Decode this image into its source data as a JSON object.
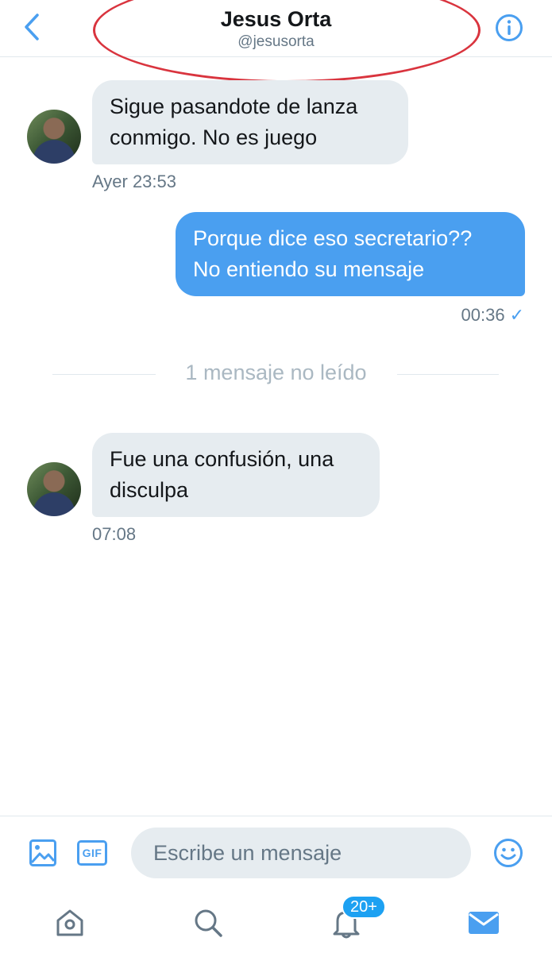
{
  "header": {
    "title": "Jesus Orta",
    "handle": "@jesusorta"
  },
  "messages": [
    {
      "direction": "in",
      "lines": [
        "Sigue pasandote de lanza",
        "conmigo. No es juego"
      ],
      "time": "Ayer 23:53"
    },
    {
      "direction": "out",
      "lines": [
        "Porque dice eso secretario??",
        "No entiendo su mensaje"
      ],
      "time": "00:36",
      "status": "✓"
    },
    {
      "direction": "in",
      "lines": [
        "Fue una confusión, una",
        "disculpa"
      ],
      "time": "07:08"
    }
  ],
  "unread_divider": "1 mensaje no leído",
  "composer": {
    "placeholder": "Escribe un mensaje",
    "gif_label": "GIF"
  },
  "tabbar": {
    "notifications_badge": "20+"
  },
  "colors": {
    "accent": "#4a9ff0",
    "incoming_bubble": "#e6ecf0",
    "annotation_oval": "#d9343e"
  }
}
